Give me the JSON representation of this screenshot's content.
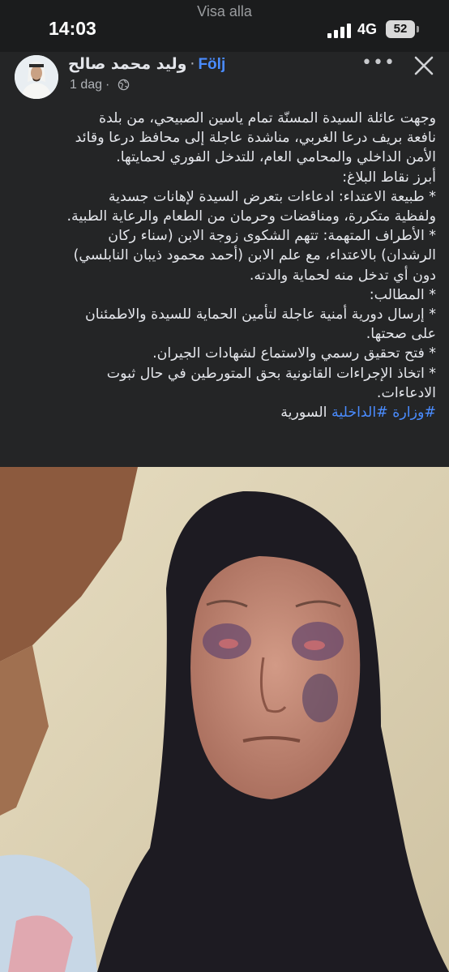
{
  "status_bar": {
    "banner": "Visa alla",
    "time": "14:03",
    "network": "4G",
    "battery": "52"
  },
  "post": {
    "author": "وليد محمد صالح",
    "follow_label": "Följ",
    "timestamp": "1 dag",
    "more_label": "•••",
    "body_lines": [
      "وجهت عائلة السيدة المسنّة تمام ياسين الصبيحي، من بلدة",
      "نافعة بريف درعا الغربي، مناشدة عاجلة إلى محافظ درعا وقائد",
      "الأمن الداخلي والمحامي العام، للتدخل الفوري لحمايتها.",
      "أبرز نقاط البلاغ:",
      "* طبيعة الاعتداء: ادعاءات بتعرض السيدة لإهانات جسدية",
      "ولفظية متكررة، ومناقضات وحرمان من الطعام والرعاية الطبية.",
      "* الأطراف المتهمة: تتهم الشكوى زوجة الابن (سناء ركان",
      "الرشدان) بالاعتداء، مع علم الابن (أحمد محمود ذيبان النابلسي)",
      "دون أي تدخل منه لحماية والدته.",
      "* المطالب:",
      "* إرسال دورية أمنية عاجلة لتأمين الحماية للسيدة والاطمئنان",
      "على صحتها.",
      "* فتح تحقيق رسمي والاستماع لشهادات الجيران.",
      "* اتخاذ الإجراءات القانونية بحق المتورطين في حال ثبوت",
      "الادعاءات."
    ],
    "hashtag_line": {
      "hashtag": "#وزارة #الداخلية",
      "rest": " السورية"
    }
  },
  "colors": {
    "background": "#242526",
    "link": "#4a8cff",
    "text": "#e4e6eb",
    "secondary": "#b0b3b8"
  },
  "icons": [
    "signal-icon",
    "battery-icon",
    "globe-icon",
    "more-icon",
    "close-icon"
  ]
}
